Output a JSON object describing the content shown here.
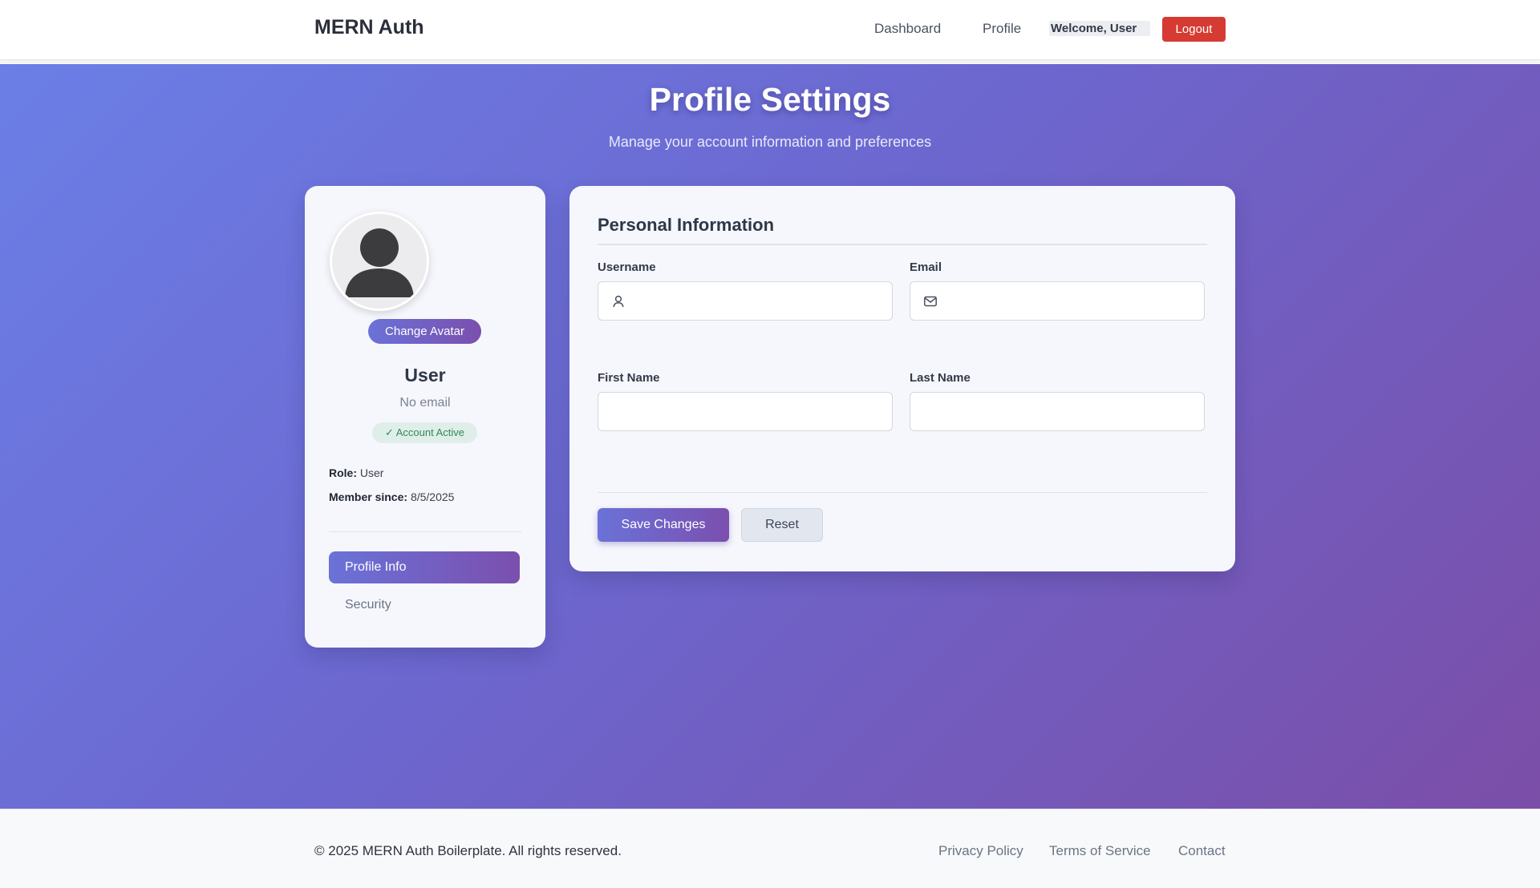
{
  "header": {
    "brand": "MERN Auth",
    "nav": [
      "Dashboard",
      "Profile"
    ],
    "welcome": "Welcome, User",
    "logout_label": "Logout"
  },
  "page": {
    "title": "Profile Settings",
    "subtitle": "Manage your account information and preferences"
  },
  "sidebar": {
    "change_avatar_label": "Change Avatar",
    "name": "User",
    "email": "No email",
    "status_badge": "✓ Account Active",
    "role_label": "Role:",
    "role_value": "User",
    "member_since_label": "Member since:",
    "member_since_value": "8/5/2025",
    "menu": [
      "Profile Info",
      "Security"
    ]
  },
  "form": {
    "section_title": "Personal Information",
    "fields": {
      "username": {
        "label": "Username",
        "value": "",
        "icon": "user-icon"
      },
      "email": {
        "label": "Email",
        "value": "",
        "icon": "mail-icon"
      },
      "first_name": {
        "label": "First Name",
        "value": ""
      },
      "last_name": {
        "label": "Last Name",
        "value": ""
      }
    },
    "save_label": "Save Changes",
    "reset_label": "Reset"
  },
  "footer": {
    "copyright": "© 2025 MERN Auth Boilerplate. All rights reserved.",
    "links": [
      "Privacy Policy",
      "Terms of Service",
      "Contact"
    ]
  },
  "colors": {
    "accent_gradient_start": "#6a72d8",
    "accent_gradient_end": "#7b4fae",
    "logout": "#d53b32",
    "badge_text": "#2f8a5e"
  }
}
